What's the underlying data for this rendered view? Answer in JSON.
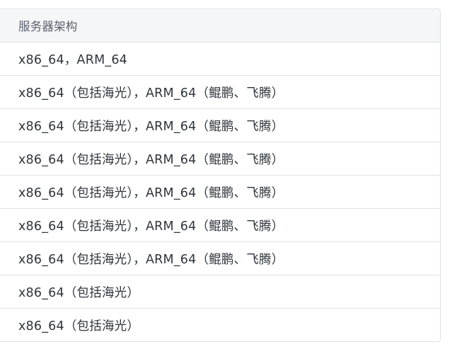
{
  "table": {
    "header": "服务器架构",
    "rows": [
      "x86_64，ARM_64",
      "x86_64（包括海光），ARM_64（鲲鹏、飞腾）",
      "x86_64（包括海光），ARM_64（鲲鹏、飞腾）",
      "x86_64（包括海光），ARM_64（鲲鹏、飞腾）",
      "x86_64（包括海光），ARM_64（鲲鹏、飞腾）",
      "x86_64（包括海光），ARM_64（鲲鹏、飞腾）",
      "x86_64（包括海光），ARM_64（鲲鹏、飞腾）",
      "x86_64（包括海光）",
      "x86_64（包括海光）"
    ]
  }
}
